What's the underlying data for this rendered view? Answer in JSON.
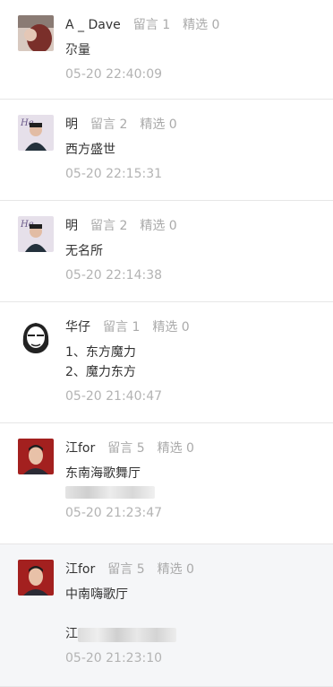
{
  "comments": [
    {
      "name": "A _ Dave",
      "replies": "留言 1",
      "picks": "精选 0",
      "lines": [
        "尕量"
      ],
      "time": "05-20 22:40:09"
    },
    {
      "name": "明",
      "replies": "留言 2",
      "picks": "精选 0",
      "lines": [
        "西方盛世"
      ],
      "time": "05-20 22:15:31"
    },
    {
      "name": "明",
      "replies": "留言 2",
      "picks": "精选 0",
      "lines": [
        "无名所"
      ],
      "time": "05-20 22:14:38"
    },
    {
      "name": "华仔",
      "replies": "留言 1",
      "picks": "精选 0",
      "lines": [
        "1、东方魔力",
        "2、魔力东方"
      ],
      "time": "05-20 21:40:47"
    },
    {
      "name": "江for",
      "replies": "留言 5",
      "picks": "精选 0",
      "lines": [
        "东南海歌舞厅"
      ],
      "time": "05-20 21:23:47"
    },
    {
      "name": "江for",
      "replies": "留言 5",
      "picks": "精选 0",
      "lines": [
        "中南嗨歌厅",
        "",
        "江"
      ],
      "time": "05-20 21:23:10"
    }
  ],
  "colors": {
    "name": "#333333",
    "stat": "#aaaaaa",
    "time": "#b3b3b3",
    "divider": "#e6e6e6",
    "highlight_bg": "#f5f6f8"
  }
}
